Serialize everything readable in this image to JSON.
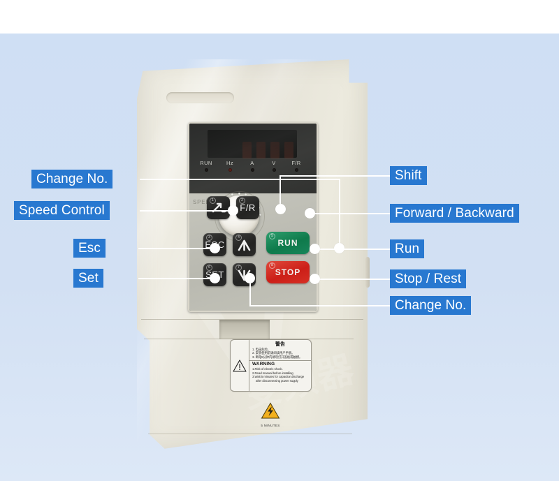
{
  "scene": {
    "subject": "vfd-inverter-front-panel",
    "background_color": "#d2e0f3",
    "label_color": "#2878d0",
    "leader_color": "#ffffff"
  },
  "device": {
    "display": {
      "indicators": [
        {
          "label": "RUN",
          "lit": false
        },
        {
          "label": "Hz",
          "lit": true
        },
        {
          "label": "A",
          "lit": false
        },
        {
          "label": "V",
          "lit": false
        },
        {
          "label": "F/R",
          "lit": false
        }
      ],
      "speed_label": "SPEED"
    },
    "buttons": [
      {
        "id": "shift",
        "num": "1",
        "cap": "",
        "kind": "dark",
        "glyph": "shift-arrow-icon"
      },
      {
        "id": "fr",
        "num": "2",
        "cap": "F/R",
        "kind": "dark",
        "glyph": "fwd-rev-icon"
      },
      {
        "id": "esc",
        "num": "3",
        "cap": "ESC",
        "kind": "dark",
        "glyph": "esc-icon"
      },
      {
        "id": "up",
        "num": "4",
        "cap": "",
        "kind": "dark",
        "glyph": "arrow-up-icon"
      },
      {
        "id": "set",
        "num": "6",
        "cap": "SET",
        "kind": "dark",
        "glyph": "set-icon"
      },
      {
        "id": "down",
        "num": "7",
        "cap": "",
        "kind": "dark",
        "glyph": "arrow-down-icon"
      },
      {
        "id": "run",
        "num": "5",
        "cap": "RUN",
        "kind": "green",
        "glyph": "run-icon"
      },
      {
        "id": "stop",
        "num": "8",
        "cap": "STOP",
        "kind": "red",
        "glyph": "stop-icon"
      }
    ],
    "warning_sticker": {
      "cn_title": "警告",
      "cn_lines": [
        "1. 电击危险。",
        "2. 安装使用前请阅读用户手册。",
        "3. 断电5分钟内请勿打开盖板或触摸。"
      ],
      "en_title": "WARNING",
      "en_lines": [
        "1.Risk of electric shock.",
        "2.Read manual before installing",
        "3.Wait 5 minutes for capacitor discharge",
        "after disconnecting power supply"
      ],
      "bolt_caption": "5 MINUTES"
    }
  },
  "callouts": {
    "left": [
      {
        "id": "change-no-top",
        "label": "Change No."
      },
      {
        "id": "speed-control",
        "label": "Speed Control"
      },
      {
        "id": "esc",
        "label": "Esc"
      },
      {
        "id": "set",
        "label": "Set"
      }
    ],
    "right": [
      {
        "id": "shift",
        "label": "Shift"
      },
      {
        "id": "forward-backward",
        "label": "Forward / Backward"
      },
      {
        "id": "run",
        "label": "Run"
      },
      {
        "id": "stop-rest",
        "label": "Stop / Rest"
      },
      {
        "id": "change-no-bottom",
        "label": "Change  No."
      }
    ]
  }
}
